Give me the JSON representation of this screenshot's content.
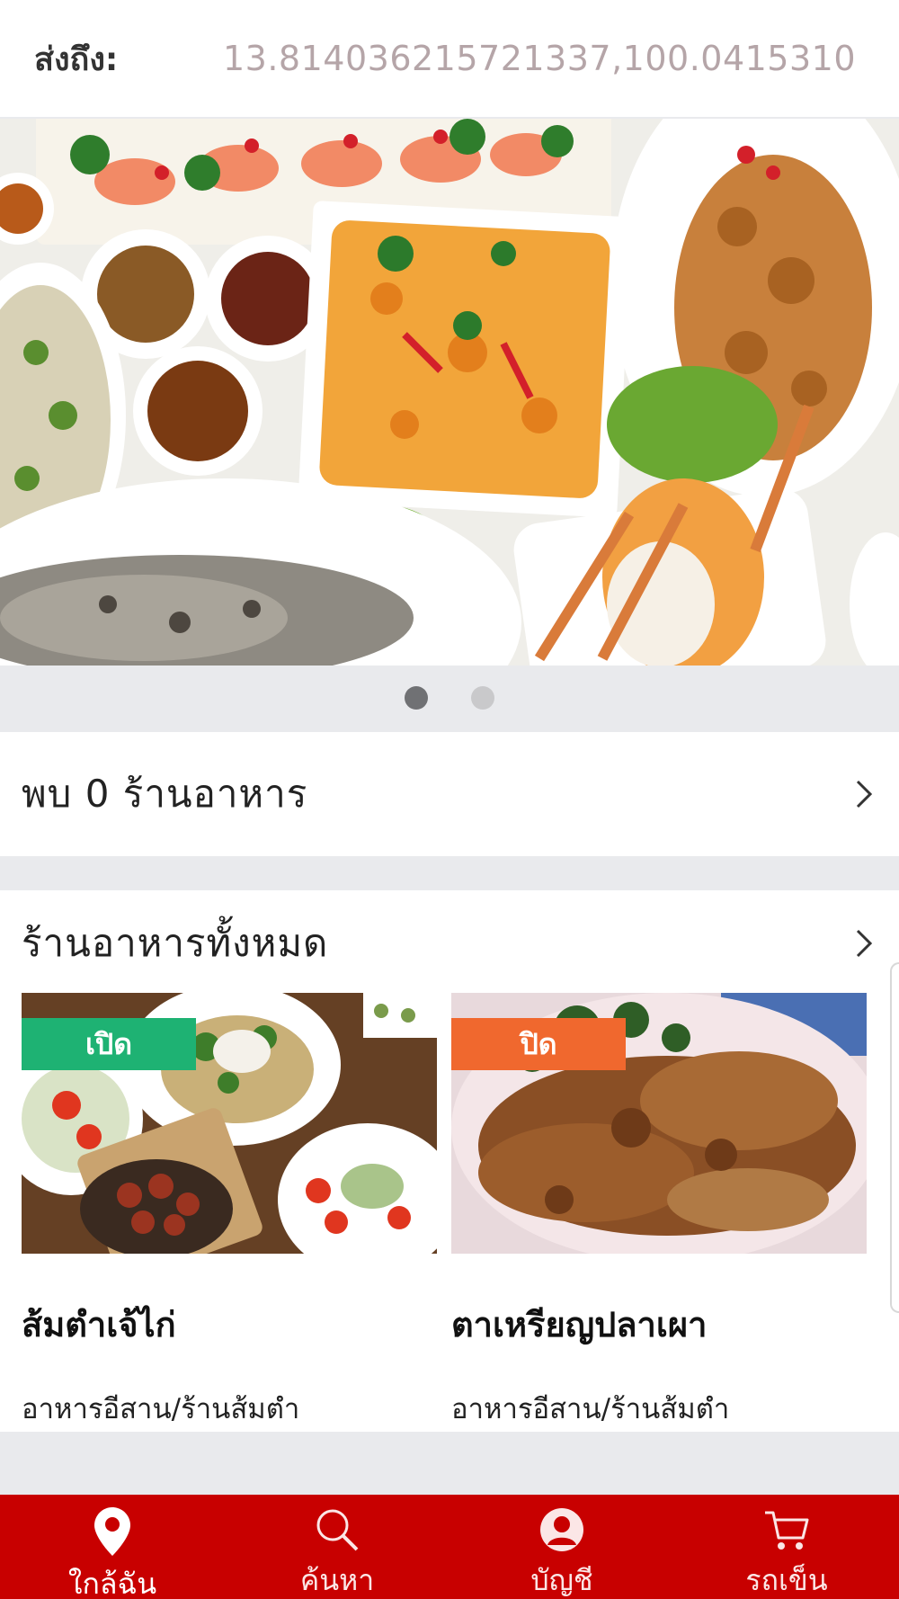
{
  "delivery": {
    "label": "ส่งถึง:",
    "coordinates": "13.814036215721337,100.0415310"
  },
  "banner": {
    "image": "thai-seafood-spread-photo",
    "slides": 2,
    "active_slide": 1
  },
  "found": {
    "text": "พบ 0 ร้านอาหาร"
  },
  "all_restaurants": {
    "title": "ร้านอาหารทั้งหมด",
    "items": [
      {
        "status": "เปิด",
        "status_color": "#1eb273",
        "name": "ส้มตำเจ้ไก่",
        "category": "อาหารอีสาน/ร้านส้มตำ",
        "image": "mixed-dishes-photo"
      },
      {
        "status": "ปิด",
        "status_color": "#f0682e",
        "name": "ตาเหรียญปลาเผา",
        "category": "อาหารอีสาน/ร้านส้มตำ",
        "image": "fried-fish-photo"
      }
    ]
  },
  "bottom_nav": {
    "background": "#c80000",
    "items": [
      {
        "label": "ใกล้ฉัน",
        "icon": "location-pin-icon",
        "active": true
      },
      {
        "label": "ค้นหา",
        "icon": "search-icon",
        "active": false
      },
      {
        "label": "บัญชี",
        "icon": "user-icon",
        "active": false
      },
      {
        "label": "รถเข็น",
        "icon": "cart-icon",
        "active": false
      }
    ]
  }
}
